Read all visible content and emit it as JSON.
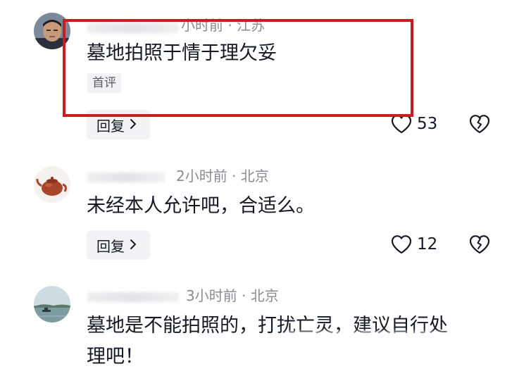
{
  "comments": [
    {
      "meta": "小时前 · 江苏",
      "text": "墓地拍照于情于理欠妥",
      "tag": "首评",
      "reply_label": "回复",
      "likes": "53"
    },
    {
      "meta": "2小时前 · 北京",
      "text": "未经本人允许吧，合适么。",
      "reply_label": "回复",
      "likes": "12"
    },
    {
      "meta": "3小时前 · 北京",
      "text_line1": "墓地是不能拍照的，打扰亡灵，建议自行处",
      "text_line2": "理吧！"
    }
  ],
  "colors": {
    "highlight_box": "#c81d1d",
    "meta_text": "#8a8b91",
    "reply_bg": "#f3f3f5",
    "tag_bg": "#f2f2f4"
  },
  "icons": {
    "like": "heart-outline-icon",
    "dislike": "broken-heart-icon",
    "reply": "chevron-right-icon"
  }
}
